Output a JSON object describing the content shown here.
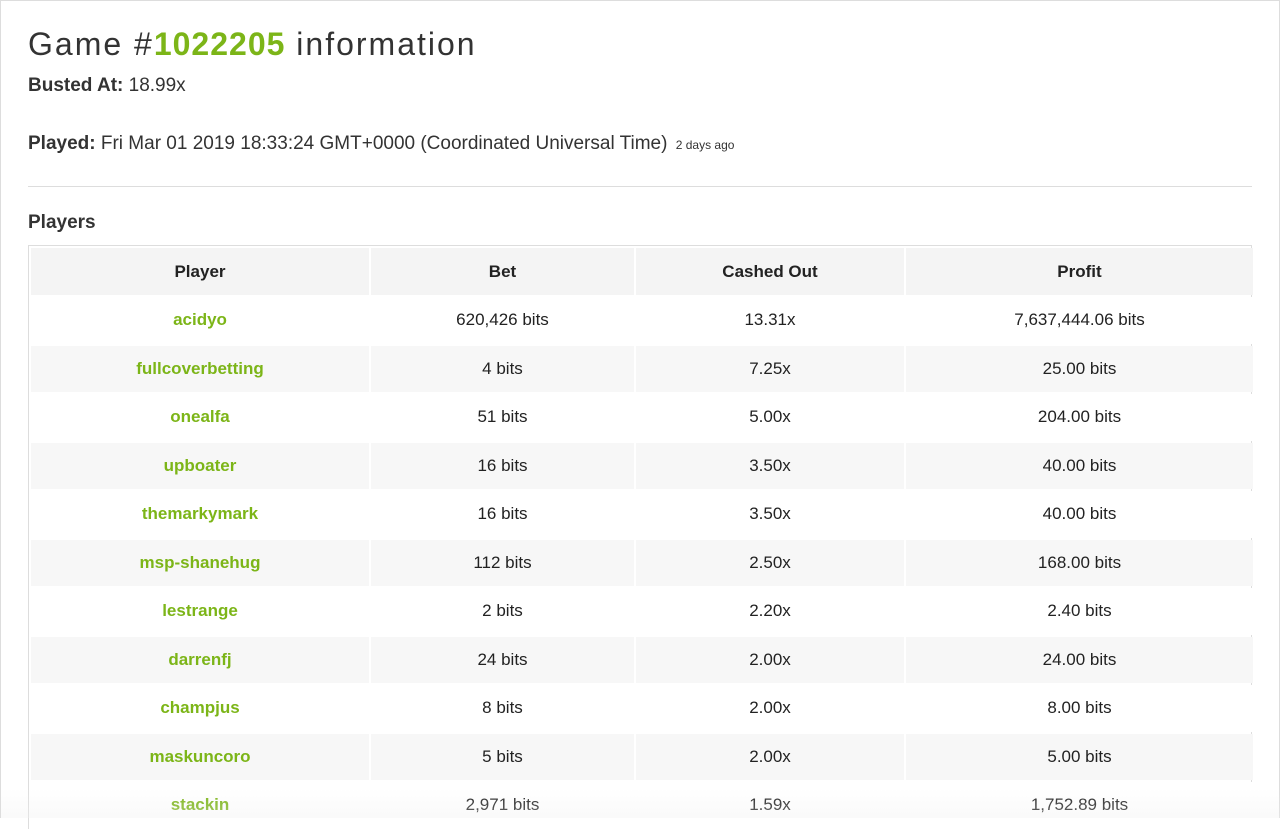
{
  "header": {
    "title_prefix": "Game #",
    "game_id": "1022205",
    "title_suffix": " information"
  },
  "busted": {
    "label": "Busted At:",
    "value": "18.99x"
  },
  "played": {
    "label": "Played:",
    "value": "Fri Mar 01 2019 18:33:24 GMT+0000 (Coordinated Universal Time)",
    "ago": "2 days ago"
  },
  "players_section": {
    "title": "Players",
    "columns": [
      "Player",
      "Bet",
      "Cashed Out",
      "Profit"
    ],
    "rows": [
      {
        "player": "acidyo",
        "bet": "620,426 bits",
        "cashed_out": "13.31x",
        "profit": "7,637,444.06 bits"
      },
      {
        "player": "fullcoverbetting",
        "bet": "4 bits",
        "cashed_out": "7.25x",
        "profit": "25.00 bits"
      },
      {
        "player": "onealfa",
        "bet": "51 bits",
        "cashed_out": "5.00x",
        "profit": "204.00 bits"
      },
      {
        "player": "upboater",
        "bet": "16 bits",
        "cashed_out": "3.50x",
        "profit": "40.00 bits"
      },
      {
        "player": "themarkymark",
        "bet": "16 bits",
        "cashed_out": "3.50x",
        "profit": "40.00 bits"
      },
      {
        "player": "msp-shanehug",
        "bet": "112 bits",
        "cashed_out": "2.50x",
        "profit": "168.00 bits"
      },
      {
        "player": "lestrange",
        "bet": "2 bits",
        "cashed_out": "2.20x",
        "profit": "2.40 bits"
      },
      {
        "player": "darrenfj",
        "bet": "24 bits",
        "cashed_out": "2.00x",
        "profit": "24.00 bits"
      },
      {
        "player": "champjus",
        "bet": "8 bits",
        "cashed_out": "2.00x",
        "profit": "8.00 bits"
      },
      {
        "player": "maskuncoro",
        "bet": "5 bits",
        "cashed_out": "2.00x",
        "profit": "5.00 bits"
      },
      {
        "player": "stackin",
        "bet": "2,971 bits",
        "cashed_out": "1.59x",
        "profit": "1,752.89 bits"
      }
    ]
  },
  "colors": {
    "accent": "#7cb518",
    "text": "#333333",
    "header_bg": "#f4f4f4",
    "row_alt_bg": "#f7f7f7",
    "border": "#dddddd"
  }
}
